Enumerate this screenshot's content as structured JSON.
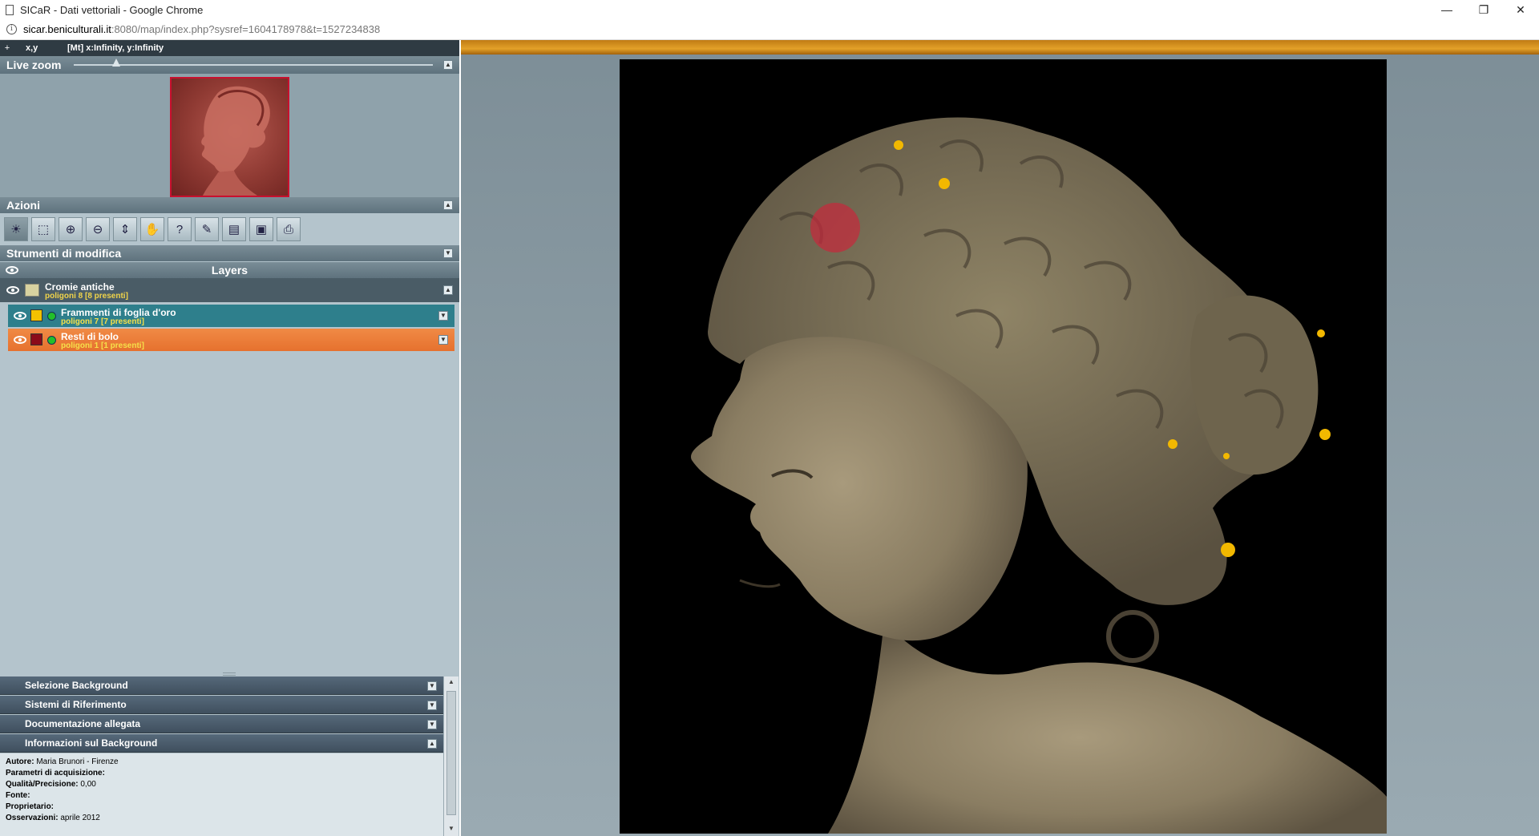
{
  "browser": {
    "window_title": "SICaR - Dati vettoriali - Google Chrome",
    "url_host": "sicar.beniculturali.it",
    "url_path": ":8080/map/index.php?sysref=1604178978&t=1527234838",
    "controls": {
      "minimize": "—",
      "restore": "❐",
      "close": "✕"
    }
  },
  "coords": {
    "label": "x,y",
    "value": "[Mt] x:Infinity, y:Infinity"
  },
  "livezoom": {
    "title": "Live zoom"
  },
  "azioni": {
    "title": "Azioni",
    "tools": [
      {
        "name": "select-tool",
        "icon": "☀"
      },
      {
        "name": "box-select-tool",
        "icon": "⬚"
      },
      {
        "name": "zoom-in-tool",
        "icon": "⊕"
      },
      {
        "name": "zoom-out-tool",
        "icon": "⊖"
      },
      {
        "name": "zoom-extent-tool",
        "icon": "⇕"
      },
      {
        "name": "pan-tool",
        "icon": "✋"
      },
      {
        "name": "help-tool",
        "icon": "?"
      },
      {
        "name": "measure-tool",
        "icon": "✎"
      },
      {
        "name": "layers-tool",
        "icon": "▤"
      },
      {
        "name": "export-tool",
        "icon": "▣"
      },
      {
        "name": "print-tool",
        "icon": "⎙"
      }
    ]
  },
  "strumenti": {
    "title": "Strumenti di modifica"
  },
  "layers": {
    "title": "Layers",
    "group": {
      "name": "Cromie antiche",
      "sub": "poligoni 8 [8 presenti]"
    },
    "items": [
      {
        "name": "Frammenti di foglia d'oro",
        "sub": "poligoni 7 [7 presenti]",
        "color": "#f2c200"
      },
      {
        "name": "Resti di bolo",
        "sub": "poligoni 1 [1 presenti]",
        "color": "#8b0a1a"
      }
    ]
  },
  "accordion": {
    "background": "Selezione Background",
    "riferimento": "Sistemi di Riferimento",
    "documentazione": "Documentazione allegata",
    "info": "Informazioni sul Background"
  },
  "info": {
    "autore_label": "Autore:",
    "autore": "Maria Brunori - Firenze",
    "parametri_label": "Parametri di acquisizione:",
    "parametri": "",
    "qualita_label": "Qualità/Precisione:",
    "qualita": "0,00",
    "fonte_label": "Fonte:",
    "fonte": "",
    "proprietario_label": "Proprietario:",
    "proprietario": "",
    "osservazioni_label": "Osservazioni:",
    "osservazioni": "aprile 2012"
  },
  "colors": {
    "accent_orange": "#e3a128",
    "layer_teal": "#2e7f8c",
    "layer_orange": "#e6712e",
    "gold_marker": "#f2b800",
    "bolo_marker": "#c8283c"
  }
}
